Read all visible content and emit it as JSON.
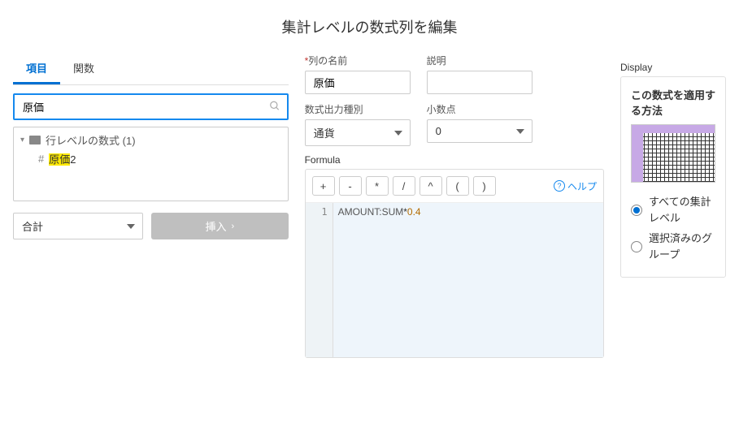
{
  "title": "集計レベルの数式列を編集",
  "tabs": {
    "items": "項目",
    "functions": "関数"
  },
  "search": {
    "value": "原価"
  },
  "tree": {
    "group_label": "行レベルの数式 (1)",
    "item_prefix": "原価",
    "item_suffix": "2"
  },
  "aggregation": {
    "selected": "合計"
  },
  "insert_button": "挿入",
  "fields": {
    "label_name": "列の名前",
    "value_name": "原価",
    "label_desc": "説明",
    "value_desc": "",
    "label_output": "数式出力種別",
    "value_output": "通貨",
    "label_decimal": "小数点",
    "value_decimal": "0"
  },
  "formula": {
    "section_label": "Formula",
    "help": "ヘルプ",
    "operators": [
      "+",
      "-",
      "*",
      "/",
      "^",
      "(",
      ")"
    ],
    "line_no": "1",
    "code_ident": "AMOUNT:SUM",
    "code_op": "*",
    "code_num": "0.4"
  },
  "display": {
    "section_label": "Display",
    "title": "この数式を適用する方法",
    "opt_all": "すべての集計レベル",
    "opt_group": "選択済みのグループ"
  }
}
